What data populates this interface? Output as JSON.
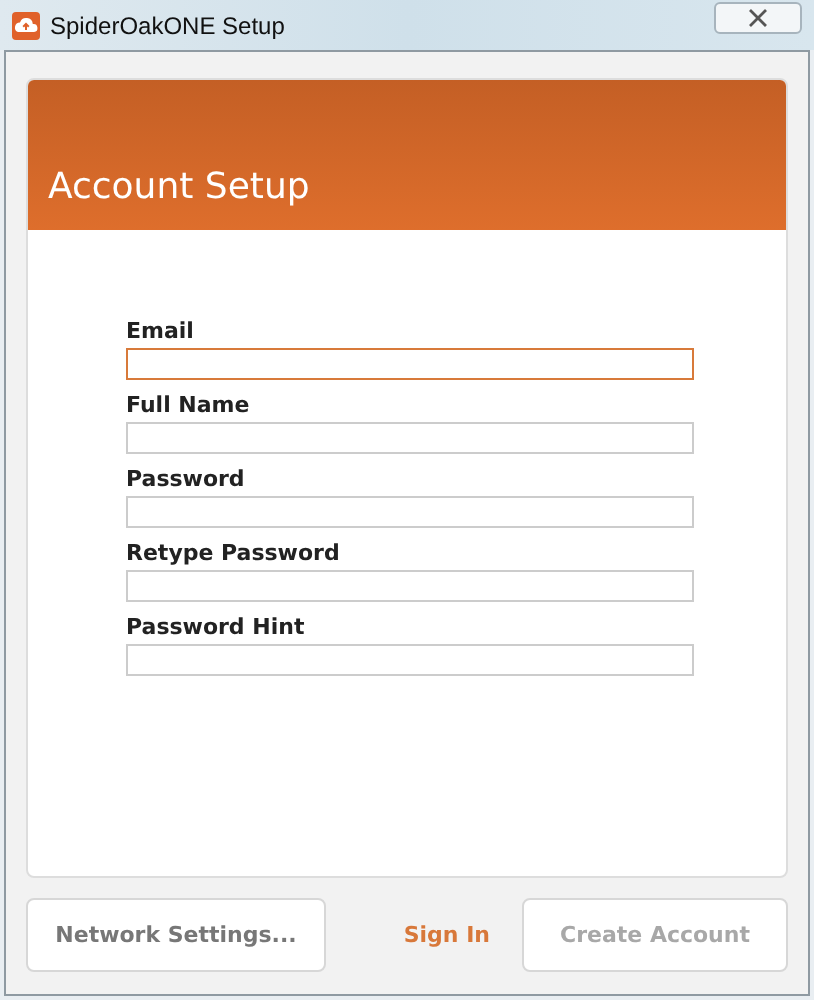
{
  "window": {
    "title": "SpiderOakONE Setup"
  },
  "header": {
    "title": "Account Setup"
  },
  "fields": [
    {
      "label": "Email",
      "focused": true
    },
    {
      "label": "Full Name",
      "focused": false
    },
    {
      "label": "Password",
      "focused": false
    },
    {
      "label": "Retype Password",
      "focused": false
    },
    {
      "label": "Password Hint",
      "focused": false
    }
  ],
  "buttons": {
    "network": {
      "label": "Network Settings..."
    },
    "sign_in": {
      "label": "Sign In"
    },
    "create": {
      "label": "Create Account",
      "disabled": true
    }
  }
}
